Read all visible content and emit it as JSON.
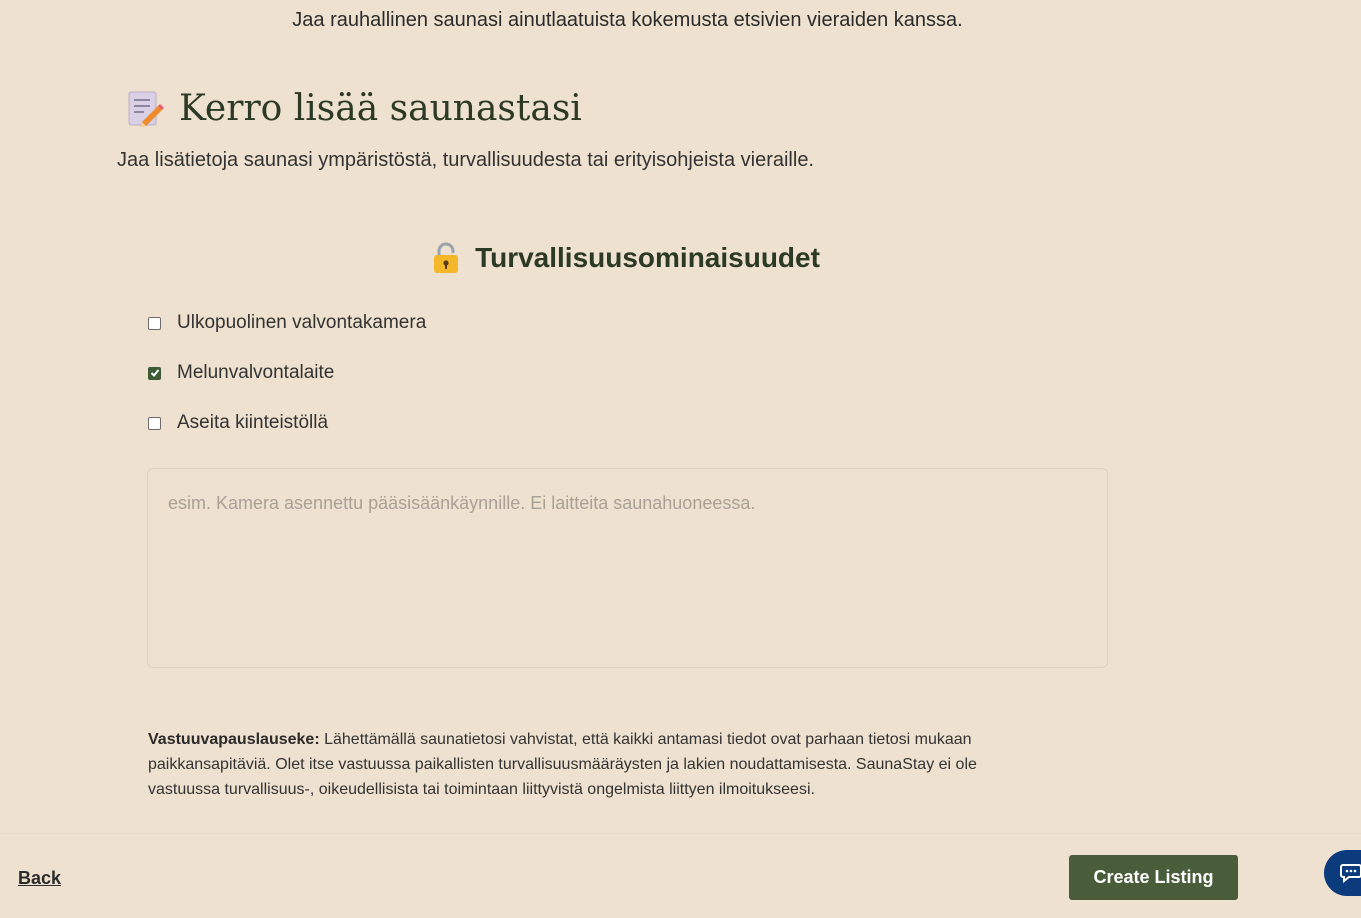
{
  "intro_text": "Jaa rauhallinen saunasi ainutlaatuista kokemusta etsivien vieraiden kanssa.",
  "section": {
    "icon": "memo-icon",
    "title": "Kerro lisää saunastasi",
    "subtitle": "Jaa lisätietoja saunasi ympäristöstä, turvallisuudesta tai erityisohjeista vieraille."
  },
  "safety": {
    "icon": "lock-icon",
    "title": "Turvallisuusominaisuudet",
    "options": [
      {
        "label": "Ulkopuolinen valvontakamera",
        "checked": false
      },
      {
        "label": "Melunvalvontalaite",
        "checked": true
      },
      {
        "label": "Aseita kiinteistöllä",
        "checked": false
      }
    ],
    "notes_placeholder": "esim. Kamera asennettu pääsisäänkäynnille. Ei laitteita saunahuoneessa."
  },
  "disclaimer": {
    "label": "Vastuuvapauslauseke:",
    "text": "Lähettämällä saunatietosi vahvistat, että kaikki antamasi tiedot ovat parhaan tietosi mukaan paikkansapitäviä. Olet itse vastuussa paikallisten turvallisuusmääräysten ja lakien noudattamisesta. SaunaStay ei ole vastuussa turvallisuus-, oikeudellisista tai toimintaan liittyvistä ongelmista liittyen ilmoitukseesi."
  },
  "footer": {
    "back_label": "Back",
    "create_label": "Create Listing"
  },
  "colors": {
    "background": "#eee1cf",
    "primary_button": "#4a5d3b",
    "chat_bubble": "#0b3b7d"
  }
}
